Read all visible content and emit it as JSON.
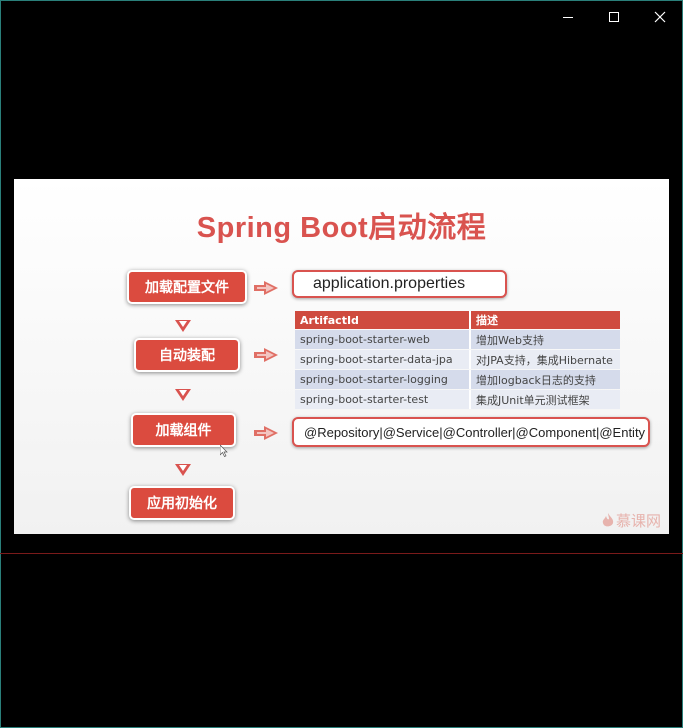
{
  "window": {
    "minimize_icon": "minimize-icon",
    "maximize_icon": "maximize-icon",
    "close_icon": "close-icon"
  },
  "slide": {
    "title": "Spring Boot启动流程",
    "steps": [
      "加载配置文件",
      "自动装配",
      "加载组件",
      "应用初始化"
    ],
    "config_file": "application.properties",
    "table": {
      "headers": [
        "ArtifactId",
        "描述"
      ],
      "rows": [
        [
          "spring-boot-starter-web",
          "增加Web支持"
        ],
        [
          "spring-boot-starter-data-jpa",
          "对JPA支持，集成Hibernate"
        ],
        [
          "spring-boot-starter-logging",
          "增加logback日志的支持"
        ],
        [
          "spring-boot-starter-test",
          "集成JUnit单元测试框架"
        ]
      ]
    },
    "annotations": "@Repository|@Service|@Controller|@Component|@Entity",
    "watermark": "慕课网",
    "colors": {
      "accent": "#d9534f",
      "step_fill": "#db4b3f",
      "table_header": "#cf4b3f"
    }
  }
}
